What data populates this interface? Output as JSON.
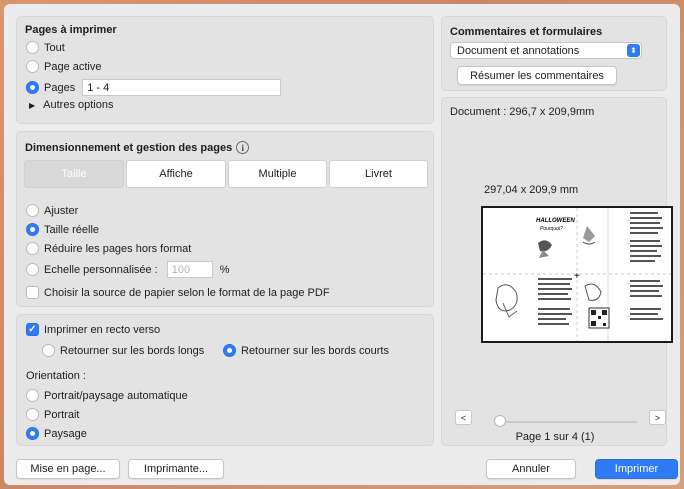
{
  "pages_section": {
    "title": "Pages à imprimer",
    "options": [
      {
        "label": "Tout",
        "selected": false
      },
      {
        "label": "Page active",
        "selected": false
      },
      {
        "label": "Pages",
        "selected": true
      }
    ],
    "pages_value": "1 - 4",
    "more_options": "Autres options"
  },
  "sizing_section": {
    "title": "Dimensionnement et gestion des pages",
    "info_icon": "i",
    "tabs": [
      "Taille",
      "Affiche",
      "Multiple",
      "Livret"
    ],
    "selected_tab": "Taille",
    "options": [
      {
        "label": "Ajuster",
        "selected": false
      },
      {
        "label": "Taille réelle",
        "selected": true
      },
      {
        "label": "Réduire les pages hors format",
        "selected": false
      },
      {
        "label": "Echelle personnalisée :",
        "selected": false
      }
    ],
    "scale_value": "100",
    "scale_unit": "%",
    "paper_source_label": "Choisir la source de papier selon le format de la page PDF",
    "paper_source_checked": false
  },
  "duplex_section": {
    "duplex_label": "Imprimer en recto verso",
    "duplex_checked": true,
    "flip_long": "Retourner sur les bords longs",
    "flip_short": "Retourner sur les bords courts",
    "flip_selected": "short",
    "orientation_title": "Orientation :",
    "orientation_options": [
      {
        "label": "Portrait/paysage automatique",
        "selected": false
      },
      {
        "label": "Portrait",
        "selected": false
      },
      {
        "label": "Paysage",
        "selected": true
      }
    ]
  },
  "comments_section": {
    "title": "Commentaires et formulaires",
    "select_value": "Document et annotations",
    "summarize_button": "Résumer les commentaires"
  },
  "preview_section": {
    "document_size": "Document : 296,7 x 209,9mm",
    "page_size": "297,04 x 209,9 mm",
    "prev_label": "<",
    "next_label": ">",
    "page_indicator": "Page 1 sur 4 (1)",
    "current_page_fraction": 0
  },
  "footer": {
    "page_setup": "Mise en page...",
    "printer": "Imprimante...",
    "cancel": "Annuler",
    "print": "Imprimer"
  },
  "colors": {
    "accent": "#2f7bf5",
    "background": "#ececec",
    "desktop": "#d9976f"
  }
}
